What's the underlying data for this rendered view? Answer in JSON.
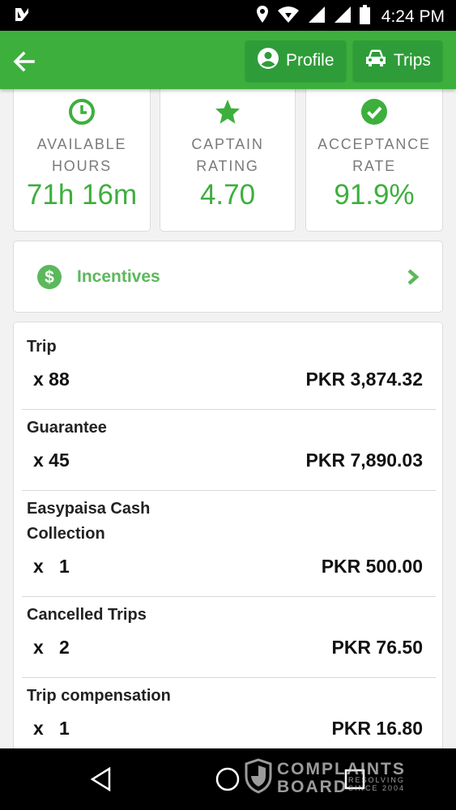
{
  "status_bar": {
    "time": "4:24 PM"
  },
  "app_bar": {
    "profile_label": "Profile",
    "trips_label": "Trips"
  },
  "stats": [
    {
      "label_1": "AVAILABLE",
      "label_2": "HOURS",
      "value": "71h 16m",
      "icon": "clock-icon"
    },
    {
      "label_1": "CAPTAIN",
      "label_2": "RATING",
      "value": "4.70",
      "icon": "star-icon"
    },
    {
      "label_1": "ACCEPTANCE",
      "label_2": "RATE",
      "value": "91.9%",
      "icon": "check-circle-icon"
    }
  ],
  "incentives": {
    "label": "Incentives",
    "icon": "dollar-circle-icon"
  },
  "earnings": [
    {
      "name_1": "Trip",
      "name_2": "",
      "qty": "x 88",
      "amount": "PKR 3,874.32"
    },
    {
      "name_1": "Guarantee",
      "name_2": "",
      "qty": "x 45",
      "amount": "PKR 7,890.03"
    },
    {
      "name_1": "Easypaisa Cash",
      "name_2": "Collection",
      "qty": "x   1",
      "amount": "PKR 500.00"
    },
    {
      "name_1": "Cancelled Trips",
      "name_2": "",
      "qty": "x   2",
      "amount": "PKR 76.50"
    },
    {
      "name_1": "Trip compensation",
      "name_2": "",
      "qty": "x   1",
      "amount": "PKR 16.80"
    }
  ],
  "watermark": {
    "line_1": "COMPLAINTS",
    "line_2": "BOARD",
    "line_3": "RESOLVING SINCE 2004"
  },
  "colors": {
    "brand_green": "#3daf3d",
    "dark_green": "#2e9c39",
    "value_green": "#3daf3d"
  }
}
